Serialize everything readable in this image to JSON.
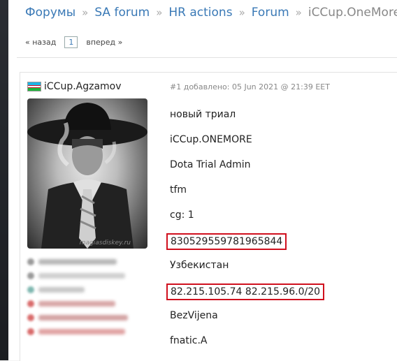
{
  "breadcrumb": {
    "items": [
      "Форумы",
      "SA forum",
      "HR actions",
      "Forum"
    ],
    "current": "iCCup.OneMore",
    "separator": "»"
  },
  "pager": {
    "prev": "« назад",
    "page": "1",
    "next": "вперед »"
  },
  "post": {
    "author": "iCCup.Agzamov",
    "meta": "#1 добавлено: 05 Jun 2021 @ 21:39 EET",
    "avatar_watermark": "magiasdiskey.ru",
    "lines": [
      "новый триал",
      "iCCup.ONEMORE",
      "Dota Trial Admin",
      "tfm",
      "cg: 1",
      "830529559781965844",
      "Узбекистан",
      "82.215.105.74 82.215.96.0/20",
      "BezVijena",
      "fnatic.A"
    ]
  },
  "colors": {
    "link": "#3a79b6",
    "highlight_border": "#d0101e"
  }
}
